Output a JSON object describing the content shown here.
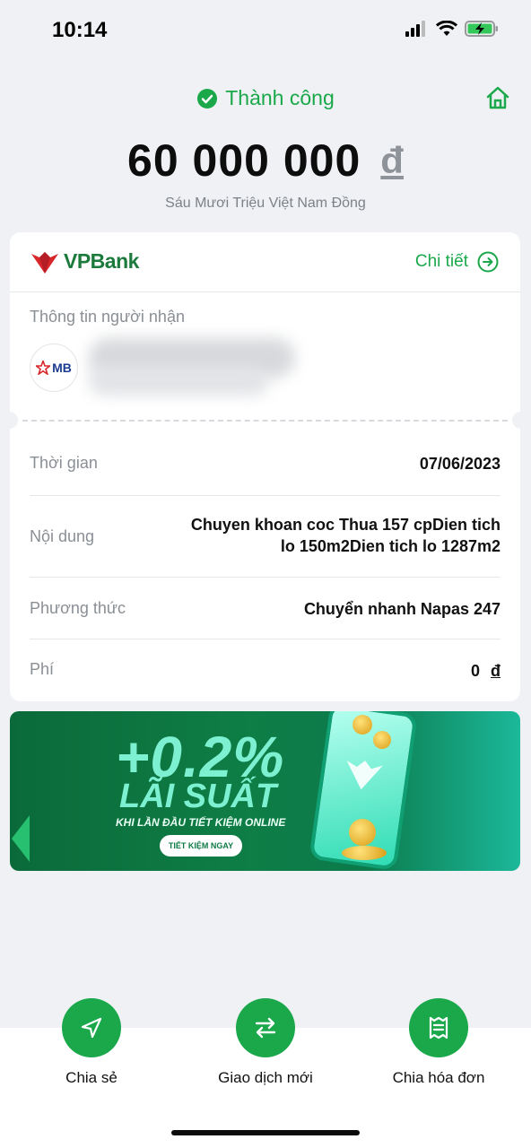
{
  "status_bar": {
    "time": "10:14"
  },
  "header": {
    "status_text": "Thành công"
  },
  "amount": {
    "value": "60 000 000",
    "currency": "đ",
    "in_words": "Sáu Mươi Triệu Việt Nam Đồng"
  },
  "bank": {
    "name": "VPBank",
    "detail_label": "Chi tiết"
  },
  "recipient": {
    "section_label": "Thông tin người nhận",
    "bank_logo_text": "MB"
  },
  "details": [
    {
      "label": "Thời gian",
      "value": "07/06/2023"
    },
    {
      "label": "Nội dung",
      "value_line1": "Chuyen khoan coc Thua 157 cpDien tich",
      "value_line2": "lo 150m2Dien tich lo 1287m2"
    },
    {
      "label": "Phương thức",
      "value": "Chuyển nhanh Napas 247"
    },
    {
      "label": "Phí",
      "value": "0",
      "currency": "đ"
    }
  ],
  "banner": {
    "rate": "+0.2%",
    "title": "LÃI SUẤT",
    "subtitle": "KHI LẦN ĐẦU TIẾT KIỆM ONLINE",
    "button": "TIẾT KIỆM NGAY"
  },
  "actions": [
    {
      "label": "Chia sẻ",
      "icon": "send-icon"
    },
    {
      "label": "Giao dịch mới",
      "icon": "swap-icon"
    },
    {
      "label": "Chia hóa đơn",
      "icon": "receipt-icon"
    }
  ],
  "colors": {
    "accent": "#1aa84a",
    "background": "#eff1f4",
    "bank_green": "#1b7a3c",
    "bank_red": "#d9262b"
  }
}
